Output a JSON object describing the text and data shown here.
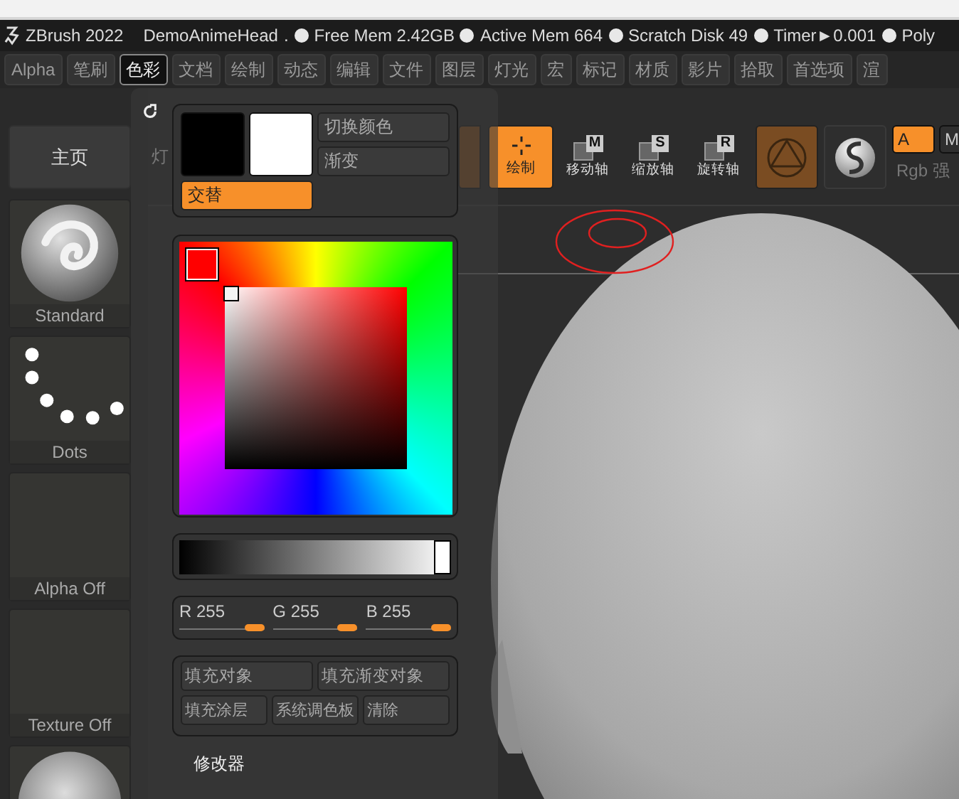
{
  "title_bar": {
    "app": "ZBrush 2022",
    "document": "DemoAnimeHead",
    "separator": ".",
    "stats": [
      "Free Mem 2.42GB",
      "Active Mem 664",
      "Scratch Disk 49",
      "Timer►0.001",
      "Poly"
    ]
  },
  "menu": [
    {
      "label": "Alpha",
      "selected": false
    },
    {
      "label": "笔刷",
      "selected": false
    },
    {
      "label": "色彩",
      "selected": true
    },
    {
      "label": "文档",
      "selected": false
    },
    {
      "label": "绘制",
      "selected": false
    },
    {
      "label": "动态",
      "selected": false
    },
    {
      "label": "编辑",
      "selected": false
    },
    {
      "label": "文件",
      "selected": false
    },
    {
      "label": "图层",
      "selected": false
    },
    {
      "label": "灯光",
      "selected": false
    },
    {
      "label": "宏",
      "selected": false
    },
    {
      "label": "标记",
      "selected": false
    },
    {
      "label": "材质",
      "selected": false
    },
    {
      "label": "影片",
      "selected": false
    },
    {
      "label": "拾取",
      "selected": false
    },
    {
      "label": "首选项",
      "selected": false
    },
    {
      "label": "渲",
      "selected": false
    }
  ],
  "shelf": {
    "home": "主页",
    "tiles": [
      {
        "kind": "brush",
        "label": "Standard"
      },
      {
        "kind": "stroke",
        "label": "Dots"
      },
      {
        "kind": "empty",
        "label": "Alpha Off"
      },
      {
        "kind": "empty",
        "label": "Texture Off"
      },
      {
        "kind": "material"
      }
    ]
  },
  "toolbar": [
    {
      "kind": "text",
      "label": "灯"
    },
    {
      "kind": "blank"
    },
    {
      "kind": "draw",
      "label": "绘制",
      "on": true
    },
    {
      "kind": "axis",
      "letter": "M",
      "label": "移动轴"
    },
    {
      "kind": "axis",
      "letter": "S",
      "label": "缩放轴"
    },
    {
      "kind": "axis",
      "letter": "R",
      "label": "旋转轴"
    },
    {
      "kind": "triangle"
    },
    {
      "kind": "sphere"
    },
    {
      "kind": "modes",
      "modes": [
        {
          "label": "A",
          "selected": true
        },
        {
          "label": "M",
          "selected": false
        }
      ],
      "caption": "Rgb 强"
    }
  ],
  "color_panel": {
    "swatches": [
      {
        "color": "#000000"
      },
      {
        "color": "#ffffff"
      }
    ],
    "buttons": [
      "切换颜色",
      "渐变"
    ],
    "alternate": {
      "label": "交替",
      "selected": true
    },
    "picker": {
      "color": "#ff0000"
    },
    "gray_slider": {
      "level": 1
    },
    "rgb": [
      {
        "label": "R",
        "value": "255",
        "level": 1
      },
      {
        "label": "G",
        "value": "255",
        "level": 1
      },
      {
        "label": "B",
        "value": "255",
        "level": 1
      }
    ],
    "fill_buttons": [
      [
        "填充对象",
        "填充渐变对象"
      ],
      [
        "填充涂层",
        "系统调色板",
        "清除"
      ]
    ],
    "modifiers": "修改器"
  }
}
